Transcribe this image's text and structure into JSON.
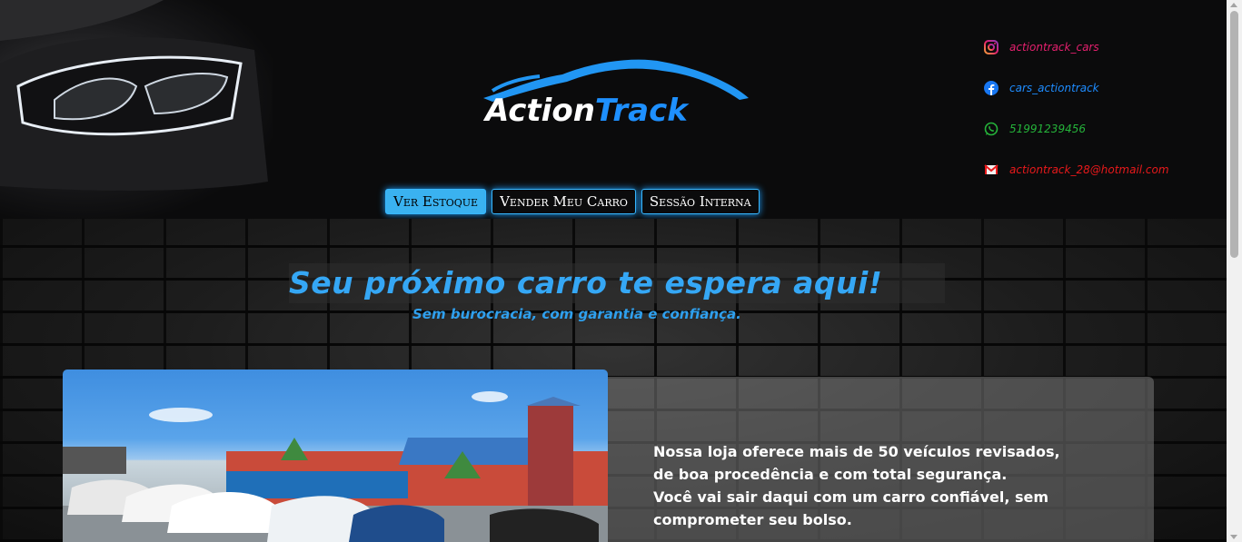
{
  "header": {
    "logo": {
      "part1": "Action",
      "part2": "Track"
    },
    "nav": [
      {
        "label": "Ver Estoque"
      },
      {
        "label": "Vender Meu Carro"
      },
      {
        "label": "Sessão Interna"
      }
    ],
    "contacts": [
      {
        "icon": "instagram-icon",
        "text": "actiontrack_cars",
        "color": "#e5206e"
      },
      {
        "icon": "facebook-icon",
        "text": "cars_actiontrack",
        "color": "#1e8cff"
      },
      {
        "icon": "whatsapp-icon",
        "text": "51991239456",
        "color": "#25b33a"
      },
      {
        "icon": "mail-icon",
        "text": "actiontrack_28@hotmail.com",
        "color": "#e8191b"
      }
    ]
  },
  "hero": {
    "title": "Seu próximo carro te espera aqui!",
    "subtitle": "Sem burocracia, com garantia e confiança.",
    "description": [
      "Nossa loja oferece mais de 50 veículos revisados,",
      "de boa procedência e com total segurança.",
      "Você vai sair daqui com um carro confiável, sem",
      "comprometer seu bolso."
    ]
  },
  "colors": {
    "accent": "#35a7f5",
    "background": "#0b0b0c"
  }
}
